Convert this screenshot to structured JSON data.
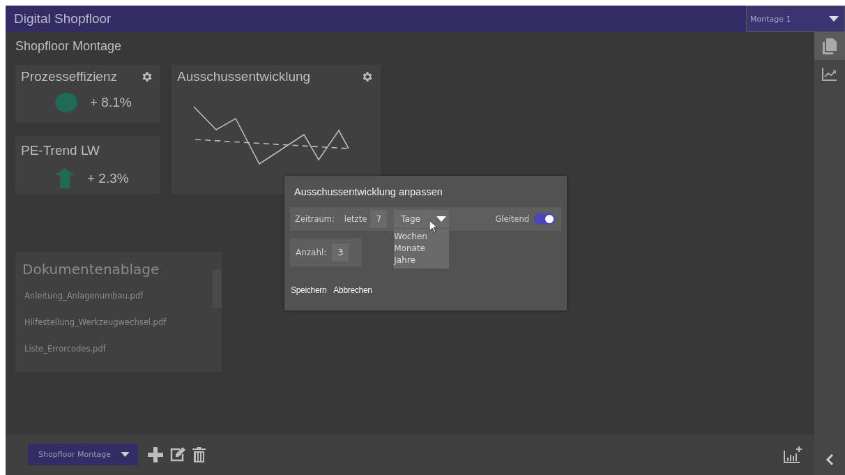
{
  "header": {
    "title": "Digital Shopfloor",
    "line_select": "Montage 1"
  },
  "page_title": "Shopfloor Montage",
  "widgets": [
    {
      "kind": "dot_kpi",
      "title": "Prozesseffizienz",
      "value": "+ 8.1%",
      "has_settings": true
    },
    {
      "kind": "chart",
      "title": "Ausschussentwicklung",
      "has_settings": true
    },
    {
      "kind": "arrow_kpi",
      "title": "PE-Trend LW",
      "value": "+ 2.3%",
      "has_settings": false
    }
  ],
  "documents": {
    "title": "Dokumentenablage",
    "files": [
      "Anleitung_Anlagenumbau.pdf",
      "Hilfestellung_Werkzeugwechsel.pdf",
      "Liste_Errorcodes.pdf"
    ]
  },
  "dialog": {
    "title": "Ausschussentwicklung anpassen",
    "period_label": "Zeitraum:",
    "period_prefix": "letzte",
    "period_count": "7",
    "unit": {
      "value": "Tage",
      "expanded": true,
      "options": [
        "Wochen",
        "Monate",
        "Jahre"
      ]
    },
    "sliding": {
      "label": "Gleitend",
      "on": true
    },
    "amount_label": "Anzahl:",
    "amount_value": "3",
    "buttons": [
      "Speichern",
      "Abbrechen"
    ]
  },
  "sidebar": [
    {
      "kind": "documents",
      "selected": true
    },
    {
      "kind": "chart",
      "selected": false
    }
  ],
  "bottom": {
    "dashboard_select": "Shopfloor Montage"
  }
}
